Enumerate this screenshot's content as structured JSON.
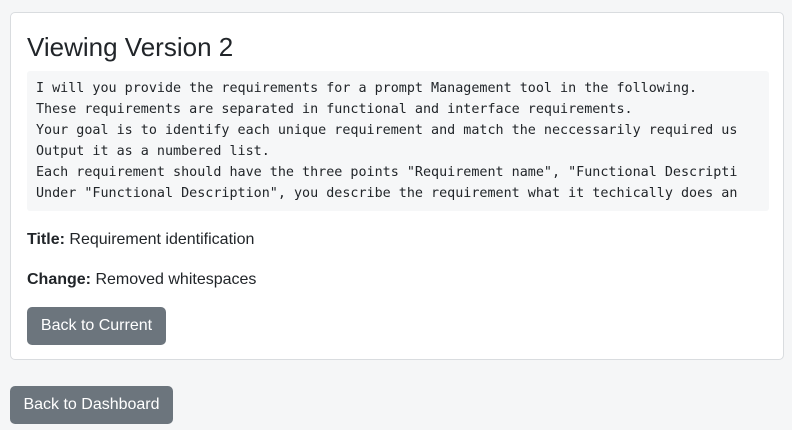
{
  "version_view": {
    "heading": "Viewing Version 2",
    "prompt_lines": [
      "I will you provide the requirements for a prompt Management tool in the following.",
      "These requirements are separated in functional and interface requirements.",
      "Your goal is to identify each unique requirement and match the neccessarily required us",
      "Output it as a numbered list.",
      "Each requirement should have the three points \"Requirement name\", \"Functional Descripti",
      "Under \"Functional Description\", you describe the requirement what it techically does an"
    ],
    "title_label": "Title:",
    "title_value": " Requirement identification",
    "change_label": "Change:",
    "change_value": " Removed whitespaces",
    "back_to_current_label": "Back to Current"
  },
  "footer": {
    "back_to_dashboard_label": "Back to Dashboard"
  },
  "colors": {
    "button_bg": "#6c757d",
    "page_bg": "#f5f6f7",
    "code_bg": "#f6f7f8"
  }
}
